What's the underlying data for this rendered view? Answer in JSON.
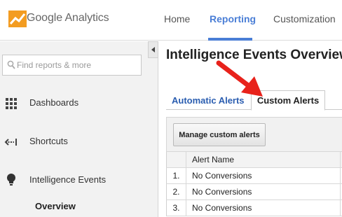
{
  "app": {
    "brand": "Google Analytics",
    "accent_color": "#4a7ed6",
    "logo_icon": "analytics-logo-icon"
  },
  "nav": {
    "items": [
      {
        "label": "Home"
      },
      {
        "label": "Reporting",
        "active": true
      },
      {
        "label": "Customization"
      }
    ]
  },
  "sidebar": {
    "search_placeholder": "Find reports & more",
    "items": [
      {
        "label": "Dashboards",
        "icon": "grid-icon"
      },
      {
        "label": "Shortcuts",
        "icon": "shortcut-arrow-icon"
      },
      {
        "label": "Intelligence Events",
        "icon": "lightbulb-icon"
      }
    ],
    "subitem": "Overview"
  },
  "main": {
    "title": "Intelligence Events Overview",
    "tabs": [
      {
        "label": "Automatic Alerts"
      },
      {
        "label": "Custom Alerts",
        "active": true
      }
    ],
    "manage_button": "Manage custom alerts",
    "table": {
      "header": "Alert Name",
      "rows": [
        {
          "num": "1.",
          "name": "No Conversions"
        },
        {
          "num": "2.",
          "name": "No Conversions"
        },
        {
          "num": "3.",
          "name": "No Conversions"
        }
      ]
    }
  }
}
